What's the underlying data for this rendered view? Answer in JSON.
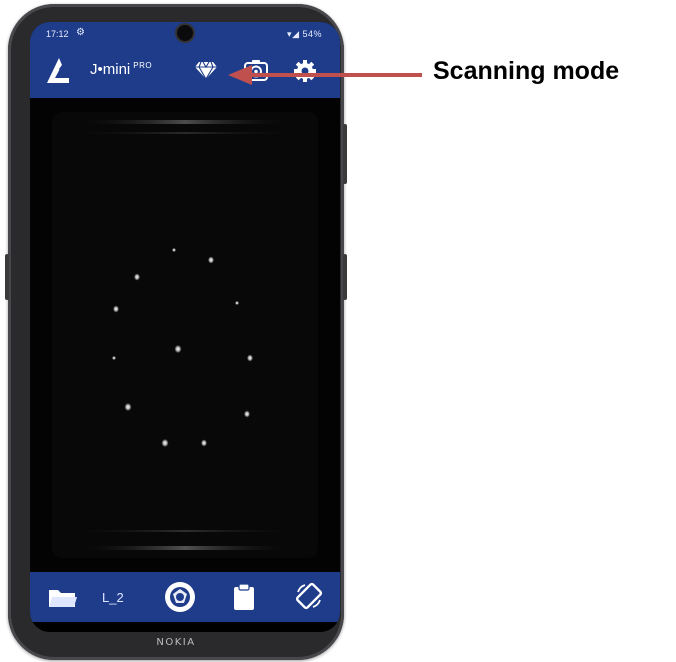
{
  "status_bar": {
    "time": "17:12",
    "right_indicators": "▾◢ 54%"
  },
  "app_bar": {
    "title": "J•mini",
    "title_suffix": "PRO",
    "logo_icon": "j-logo-icon",
    "mode_icon": "diamond-icon",
    "camera_icon": "camera-switch-icon",
    "settings_icon": "gear-icon"
  },
  "bottom_bar": {
    "folder_icon": "folder-icon",
    "lens_label": "L_2",
    "capture_icon": "capture-aperture-icon",
    "clipboard_icon": "clipboard-icon",
    "rotate_icon": "rotate-icon"
  },
  "phone_brand": "NOKIA",
  "annotation": {
    "label": "Scanning mode",
    "arrow_color": "#c0504d"
  },
  "colors": {
    "app_bar": "#1f3c8a",
    "viewport": "#030303",
    "phone_body": "#2a2a2c"
  }
}
